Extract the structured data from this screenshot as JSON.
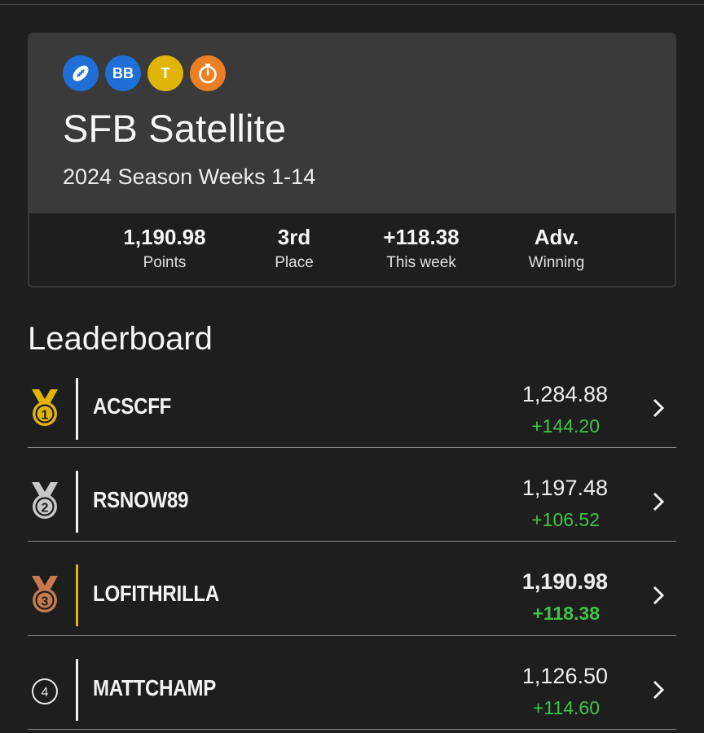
{
  "league": {
    "badges": [
      {
        "icon": "football-icon",
        "color": "#1f6fd6",
        "text": ""
      },
      {
        "icon": "bb-badge-icon",
        "color": "#1f6fd6",
        "text": "BB"
      },
      {
        "icon": "t-badge-icon",
        "color": "#e1b40c",
        "text": "T"
      },
      {
        "icon": "stopwatch-icon",
        "color": "#ea7f24",
        "text": ""
      }
    ],
    "title": "SFB Satellite",
    "subtitle": "2024 Season Weeks 1-14",
    "stats": [
      {
        "value": "1,190.98",
        "label": "Points"
      },
      {
        "value": "3rd",
        "label": "Place"
      },
      {
        "value": "+118.38",
        "label": "This week"
      },
      {
        "value": "Adv.",
        "label": "Winning"
      }
    ]
  },
  "leaderboard": {
    "title": "Leaderboard",
    "rows": [
      {
        "rank": "1",
        "medal": "gold-medal-icon",
        "name": "ACSCFF",
        "points": "1,284.88",
        "delta": "+144.20",
        "highlight": false
      },
      {
        "rank": "2",
        "medal": "silver-medal-icon",
        "name": "RSNOW89",
        "points": "1,197.48",
        "delta": "+106.52",
        "highlight": false
      },
      {
        "rank": "3",
        "medal": "bronze-medal-icon",
        "name": "LOFITHRILLA",
        "points": "1,190.98",
        "delta": "+118.38",
        "highlight": true
      },
      {
        "rank": "4",
        "medal": "rank-circle-icon",
        "name": "MATTCHAMP",
        "points": "1,126.50",
        "delta": "+114.60",
        "highlight": false
      }
    ]
  },
  "colors": {
    "gold": "#e1b40c",
    "silver": "#c8c8c8",
    "bronze": "#c8794e",
    "positive": "#3ec44a",
    "highlight_bar": "#e1b40c"
  }
}
